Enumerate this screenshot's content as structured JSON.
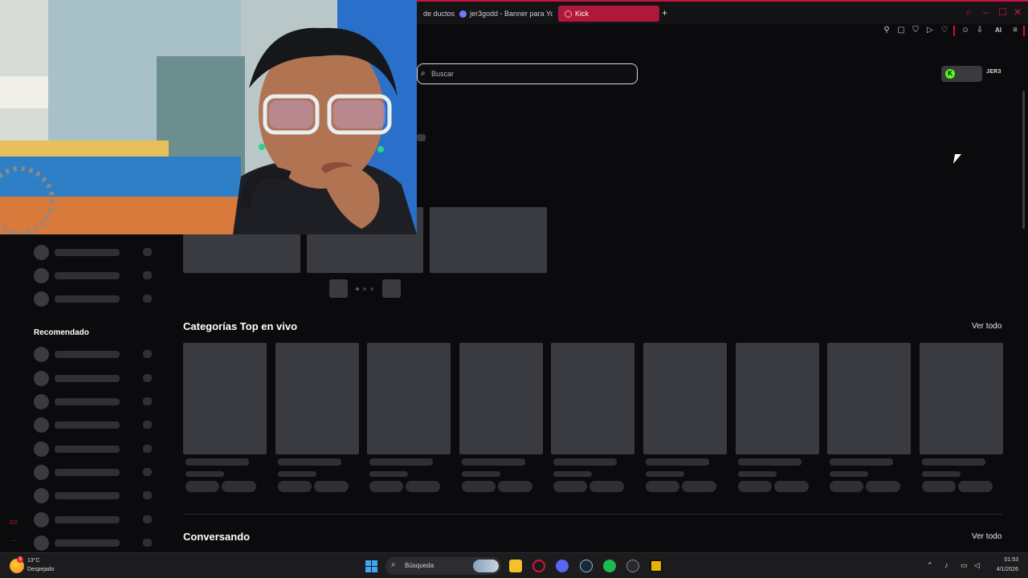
{
  "browser": {
    "tabs": [
      {
        "label": "de ductos"
      },
      {
        "label": "jer3godd - Banner para Yo"
      },
      {
        "label": "Kick",
        "active": true
      }
    ],
    "new_tab": "+",
    "accent": "#c8143c"
  },
  "toolbar": {
    "icons": [
      "pin-icon",
      "bookmark-icon",
      "shield-icon",
      "play-icon",
      "heart-icon",
      "account-icon",
      "download-icon",
      "ai-icon",
      "menu-icon"
    ],
    "ai_label": "AI"
  },
  "header": {
    "search_placeholder": "Buscar",
    "username": "JER3",
    "brand_color": "#53fc18"
  },
  "sidebar": {
    "recommended_heading": "Recomendado"
  },
  "sections": {
    "top_categories": {
      "title": "Categorías Top en vivo",
      "see_all": "Ver todo"
    },
    "conversando": {
      "title": "Conversando",
      "see_all": "Ver todo"
    }
  },
  "opera_sidebar": {
    "gx_label": "GX",
    "more_label": "···"
  },
  "taskbar": {
    "weather_temp": "13°C",
    "weather_desc": "Despejado",
    "weather_badge": "3",
    "search_label": "Búsqueda",
    "time": "01:53",
    "date": "4/1/2026"
  }
}
